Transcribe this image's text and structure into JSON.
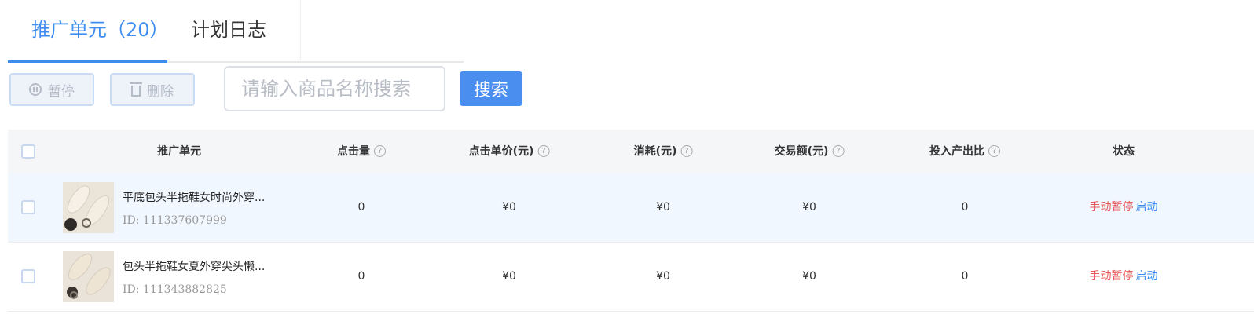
{
  "tabs": [
    {
      "label": "推广单元（20）",
      "active": true
    },
    {
      "label": "计划日志",
      "active": false
    }
  ],
  "toolbar": {
    "pause_label": "暂停",
    "delete_label": "删除",
    "search_placeholder": "请输入商品名称搜索",
    "search_value": "",
    "search_button": "搜索"
  },
  "table": {
    "headers": {
      "unit": "推广单元",
      "clicks": "点击量",
      "cpc": "点击单价(元)",
      "cost": "消耗(元)",
      "gmv": "交易额(元)",
      "roi": "投入产出比",
      "status": "状态"
    },
    "help_glyph": "?",
    "rows": [
      {
        "name": "平底包头半拖鞋女时尚外穿...",
        "id": "ID: 111337607999",
        "clicks": "0",
        "cpc": "¥0",
        "cost": "¥0",
        "gmv": "¥0",
        "roi": "0",
        "status": "手动暂停",
        "action": "启动"
      },
      {
        "name": "包头半拖鞋女夏外穿尖头懒...",
        "id": "ID: 111343882825",
        "clicks": "0",
        "cpc": "¥0",
        "cost": "¥0",
        "gmv": "¥0",
        "roi": "0",
        "status": "手动暂停",
        "action": "启动"
      }
    ]
  },
  "colors": {
    "accent": "#3d8cf0",
    "status_paused": "#e8585a",
    "row_highlight": "#f1f7ff"
  }
}
